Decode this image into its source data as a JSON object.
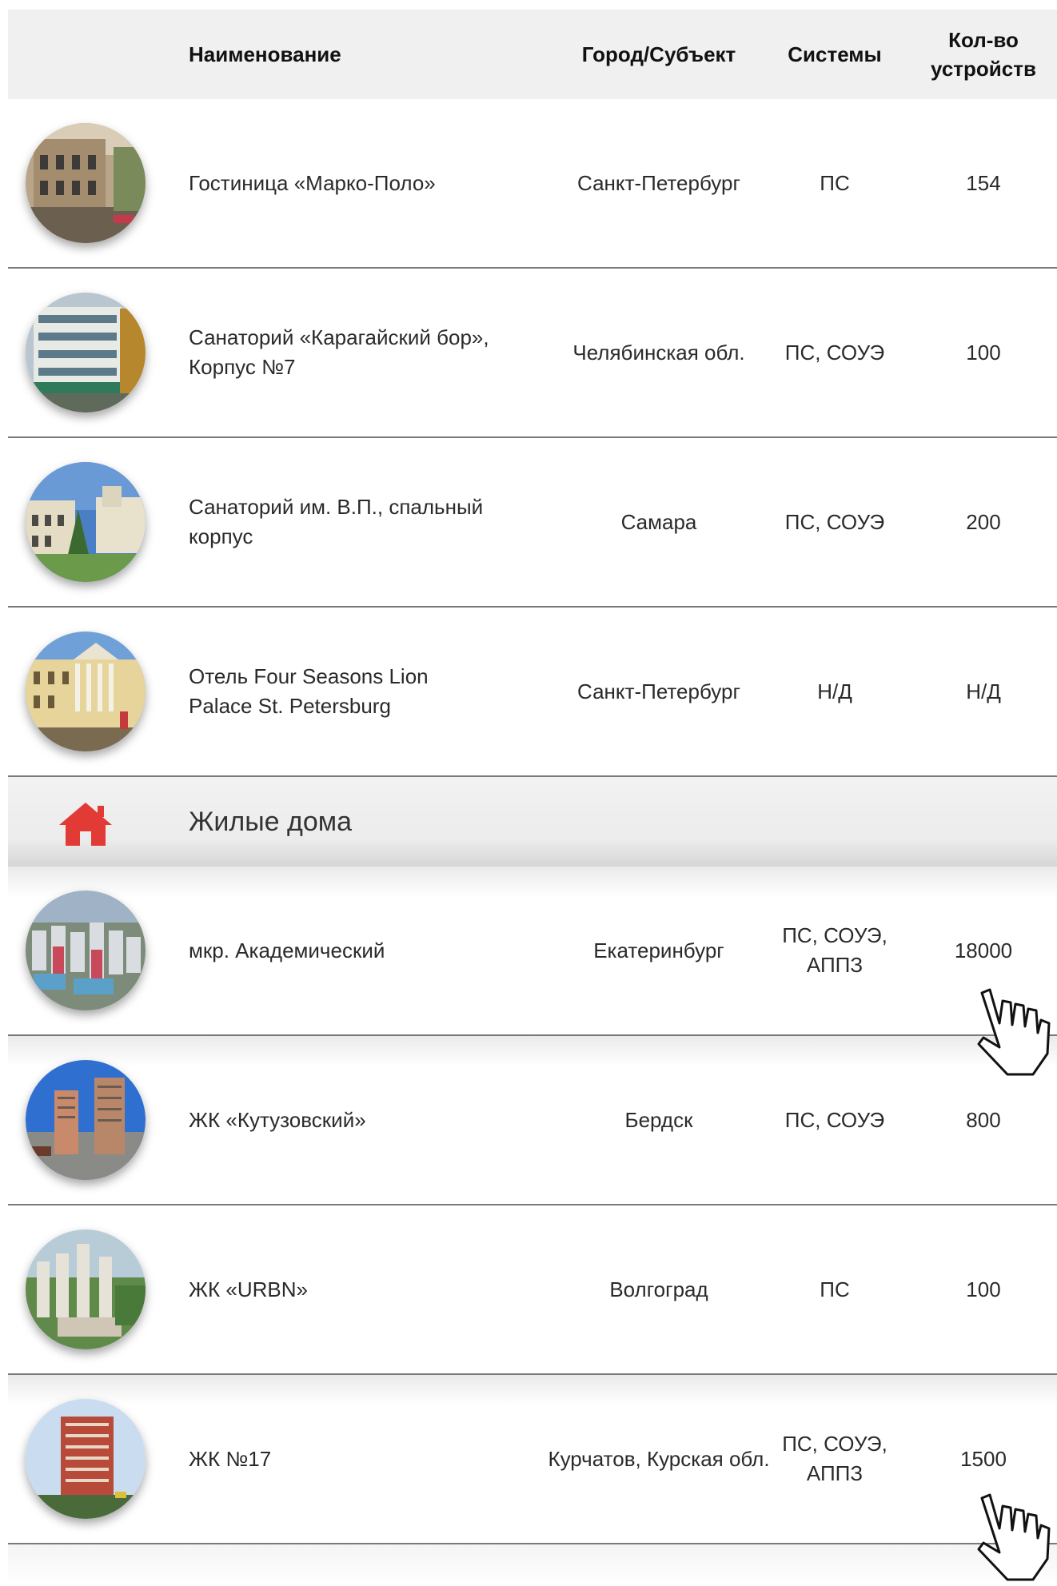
{
  "header": {
    "name": "Наименование",
    "city": "Город/Субъект",
    "systems": "Системы",
    "count_line1": "Кол-во",
    "count_line2": "устройств"
  },
  "hotels": [
    {
      "name": "Гостиница «Марко-Поло»",
      "city": "Санкт-Петербург",
      "systems": "ПС",
      "count": "154",
      "photo": "hotel-building-photo"
    },
    {
      "name": "Санаторий «Карагайский бор», Корпус №7",
      "city": "Челябинская обл.",
      "systems": "ПС, СОУЭ",
      "count": "100",
      "photo": "sanatorium-building-photo"
    },
    {
      "name": "Санаторий им. В.П., спальный корпус",
      "city": "Самара",
      "systems": "ПС, СОУЭ",
      "count": "200",
      "photo": "sanatorium-building-photo"
    },
    {
      "name": "Отель Four Seasons Lion Palace St. Petersburg",
      "city": "Санкт-Петербург",
      "systems": "Н/Д",
      "count": "Н/Д",
      "photo": "palace-hotel-photo"
    }
  ],
  "category": {
    "label": "Жилые дома",
    "icon": "home-icon",
    "icon_color": "#e23b35"
  },
  "residential": [
    {
      "name": "мкр. Академический",
      "city": "Екатеринбург",
      "systems": "ПС, СОУЭ, АППЗ",
      "count": "18000",
      "photo": "district-aerial-photo"
    },
    {
      "name": "ЖК «Кутузовский»",
      "city": "Бердск",
      "systems": "ПС, СОУЭ",
      "count": "800",
      "photo": "highrise-photo"
    },
    {
      "name": "ЖК «URBN»",
      "city": "Волгоград",
      "systems": "ПС",
      "count": "100",
      "photo": "complex-aerial-photo"
    },
    {
      "name": "ЖК №17",
      "city": "Курчатов, Курская обл.",
      "systems": "ПС, СОУЭ, АППЗ",
      "count": "1500",
      "photo": "red-highrise-photo"
    }
  ],
  "cursor_icon": "hand-pointer-icon"
}
